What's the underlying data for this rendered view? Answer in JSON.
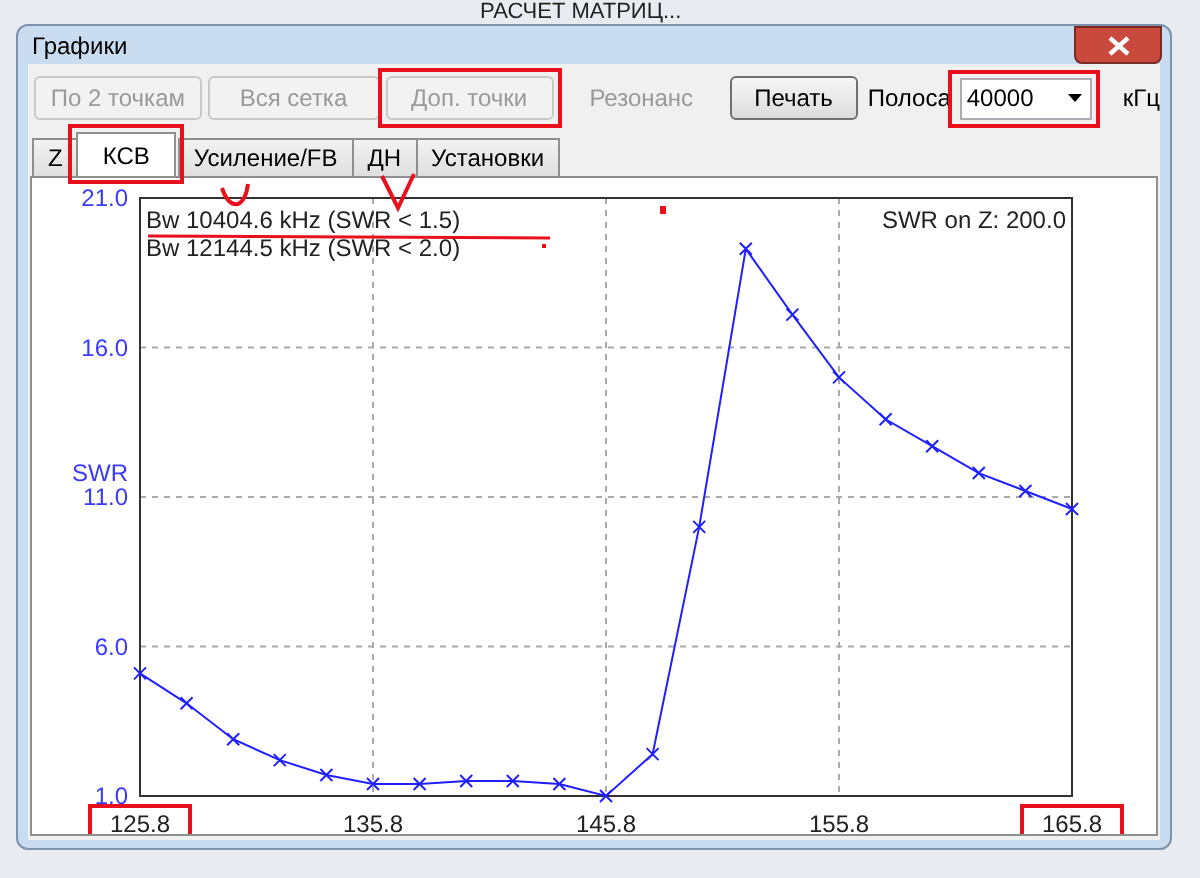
{
  "backdrop": {
    "heading": "РАСЧЕТ МАТРИЦ..."
  },
  "window": {
    "title": "Графики"
  },
  "toolbar": {
    "buttons": [
      {
        "label": "По 2 точкам",
        "disabled": true,
        "flat": false,
        "highlighted": false
      },
      {
        "label": "Вся сетка",
        "disabled": true,
        "flat": false,
        "highlighted": false
      },
      {
        "label": "Доп. точки",
        "disabled": true,
        "flat": false,
        "highlighted": true
      },
      {
        "label": "Резонанс",
        "disabled": true,
        "flat": true,
        "highlighted": false
      },
      {
        "label": "Печать",
        "disabled": false,
        "flat": false,
        "highlighted": false
      }
    ],
    "band_label": "Полоса",
    "band_value": "40000",
    "band_highlighted": true,
    "band_unit": "кГц"
  },
  "tabs": [
    {
      "label": "Z",
      "selected": false,
      "highlighted": false
    },
    {
      "label": "КСВ",
      "selected": true,
      "highlighted": true
    },
    {
      "label": "Усиление/FB",
      "selected": false,
      "highlighted": false
    },
    {
      "label": "ДН",
      "selected": false,
      "highlighted": false
    },
    {
      "label": "Установки",
      "selected": false,
      "highlighted": false
    }
  ],
  "chart": {
    "notes": [
      {
        "text": "Bw 10404.6 kHz (SWR < 1.5)",
        "underlined": true
      },
      {
        "text": "Bw 12144.5 kHz (SWR < 2.0)",
        "underlined": false
      }
    ],
    "corner_note": "SWR on Z: 200.0",
    "box_first_xtick": true,
    "box_last_xtick": true,
    "chart_data": {
      "type": "line",
      "ylabel": "SWR",
      "grid": true,
      "x": [
        125.8,
        127.8,
        129.8,
        131.8,
        133.8,
        135.8,
        137.8,
        139.8,
        141.8,
        143.8,
        145.8,
        147.8,
        149.8,
        151.8,
        153.8,
        155.8,
        157.8,
        159.8,
        161.8,
        163.8,
        165.8
      ],
      "series": [
        {
          "color": "#2020ff",
          "marker": "x",
          "values": [
            5.1,
            4.1,
            2.9,
            2.2,
            1.7,
            1.4,
            1.4,
            1.5,
            1.5,
            1.4,
            1.0,
            2.4,
            10.0,
            19.3,
            17.1,
            15.0,
            13.6,
            12.7,
            11.8,
            11.2,
            10.6
          ]
        }
      ],
      "xlim": [
        125.8,
        165.8
      ],
      "ylim": [
        1.0,
        21.0
      ],
      "xticks": [
        {
          "value": 125.8,
          "label": "125.8"
        },
        {
          "value": 135.8,
          "label": "135.8"
        },
        {
          "value": 145.8,
          "label": "145.8"
        },
        {
          "value": 155.8,
          "label": "155.8"
        },
        {
          "value": 165.8,
          "label": "165.8"
        }
      ],
      "yticks": [
        {
          "value": 1.0,
          "label": "1.0"
        },
        {
          "value": 6.0,
          "label": "6.0"
        },
        {
          "value": 11.0,
          "label": "11.0"
        },
        {
          "value": 16.0,
          "label": "16.0"
        },
        {
          "value": 21.0,
          "label": "21.0"
        }
      ]
    }
  }
}
